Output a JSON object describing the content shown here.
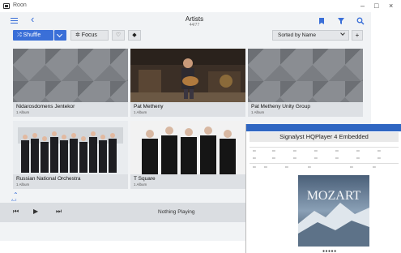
{
  "window": {
    "title": "Roon",
    "minimize_label": "–",
    "maximize_label": "□",
    "close_label": "×"
  },
  "header": {
    "title": "Artists",
    "count": "44/77"
  },
  "toolbar": {
    "shuffle_label": "⤮ Shuffle",
    "focus_label": "✲ Focus",
    "sort_label": "Sorted by Name",
    "add_label": "+"
  },
  "icons": {
    "accent": "#3a6fd8"
  },
  "artists": [
    {
      "name": "Nidarosdomens Jentekor",
      "albums": "1 Album"
    },
    {
      "name": "Pat Metheny",
      "albums": "1 Album"
    },
    {
      "name": "Pat Metheny Unity Group",
      "albums": "1 Album"
    },
    {
      "name": "Russian National Orchestra",
      "albums": "1 Album"
    },
    {
      "name": "T Square",
      "albums": "1 Album"
    }
  ],
  "scroll": {
    "up_label": "A-Z"
  },
  "player": {
    "status": "Nothing Playing"
  },
  "overlay": {
    "title": "Signalyst HQPlayer 4 Embedded",
    "cover_text": "MOZART"
  }
}
